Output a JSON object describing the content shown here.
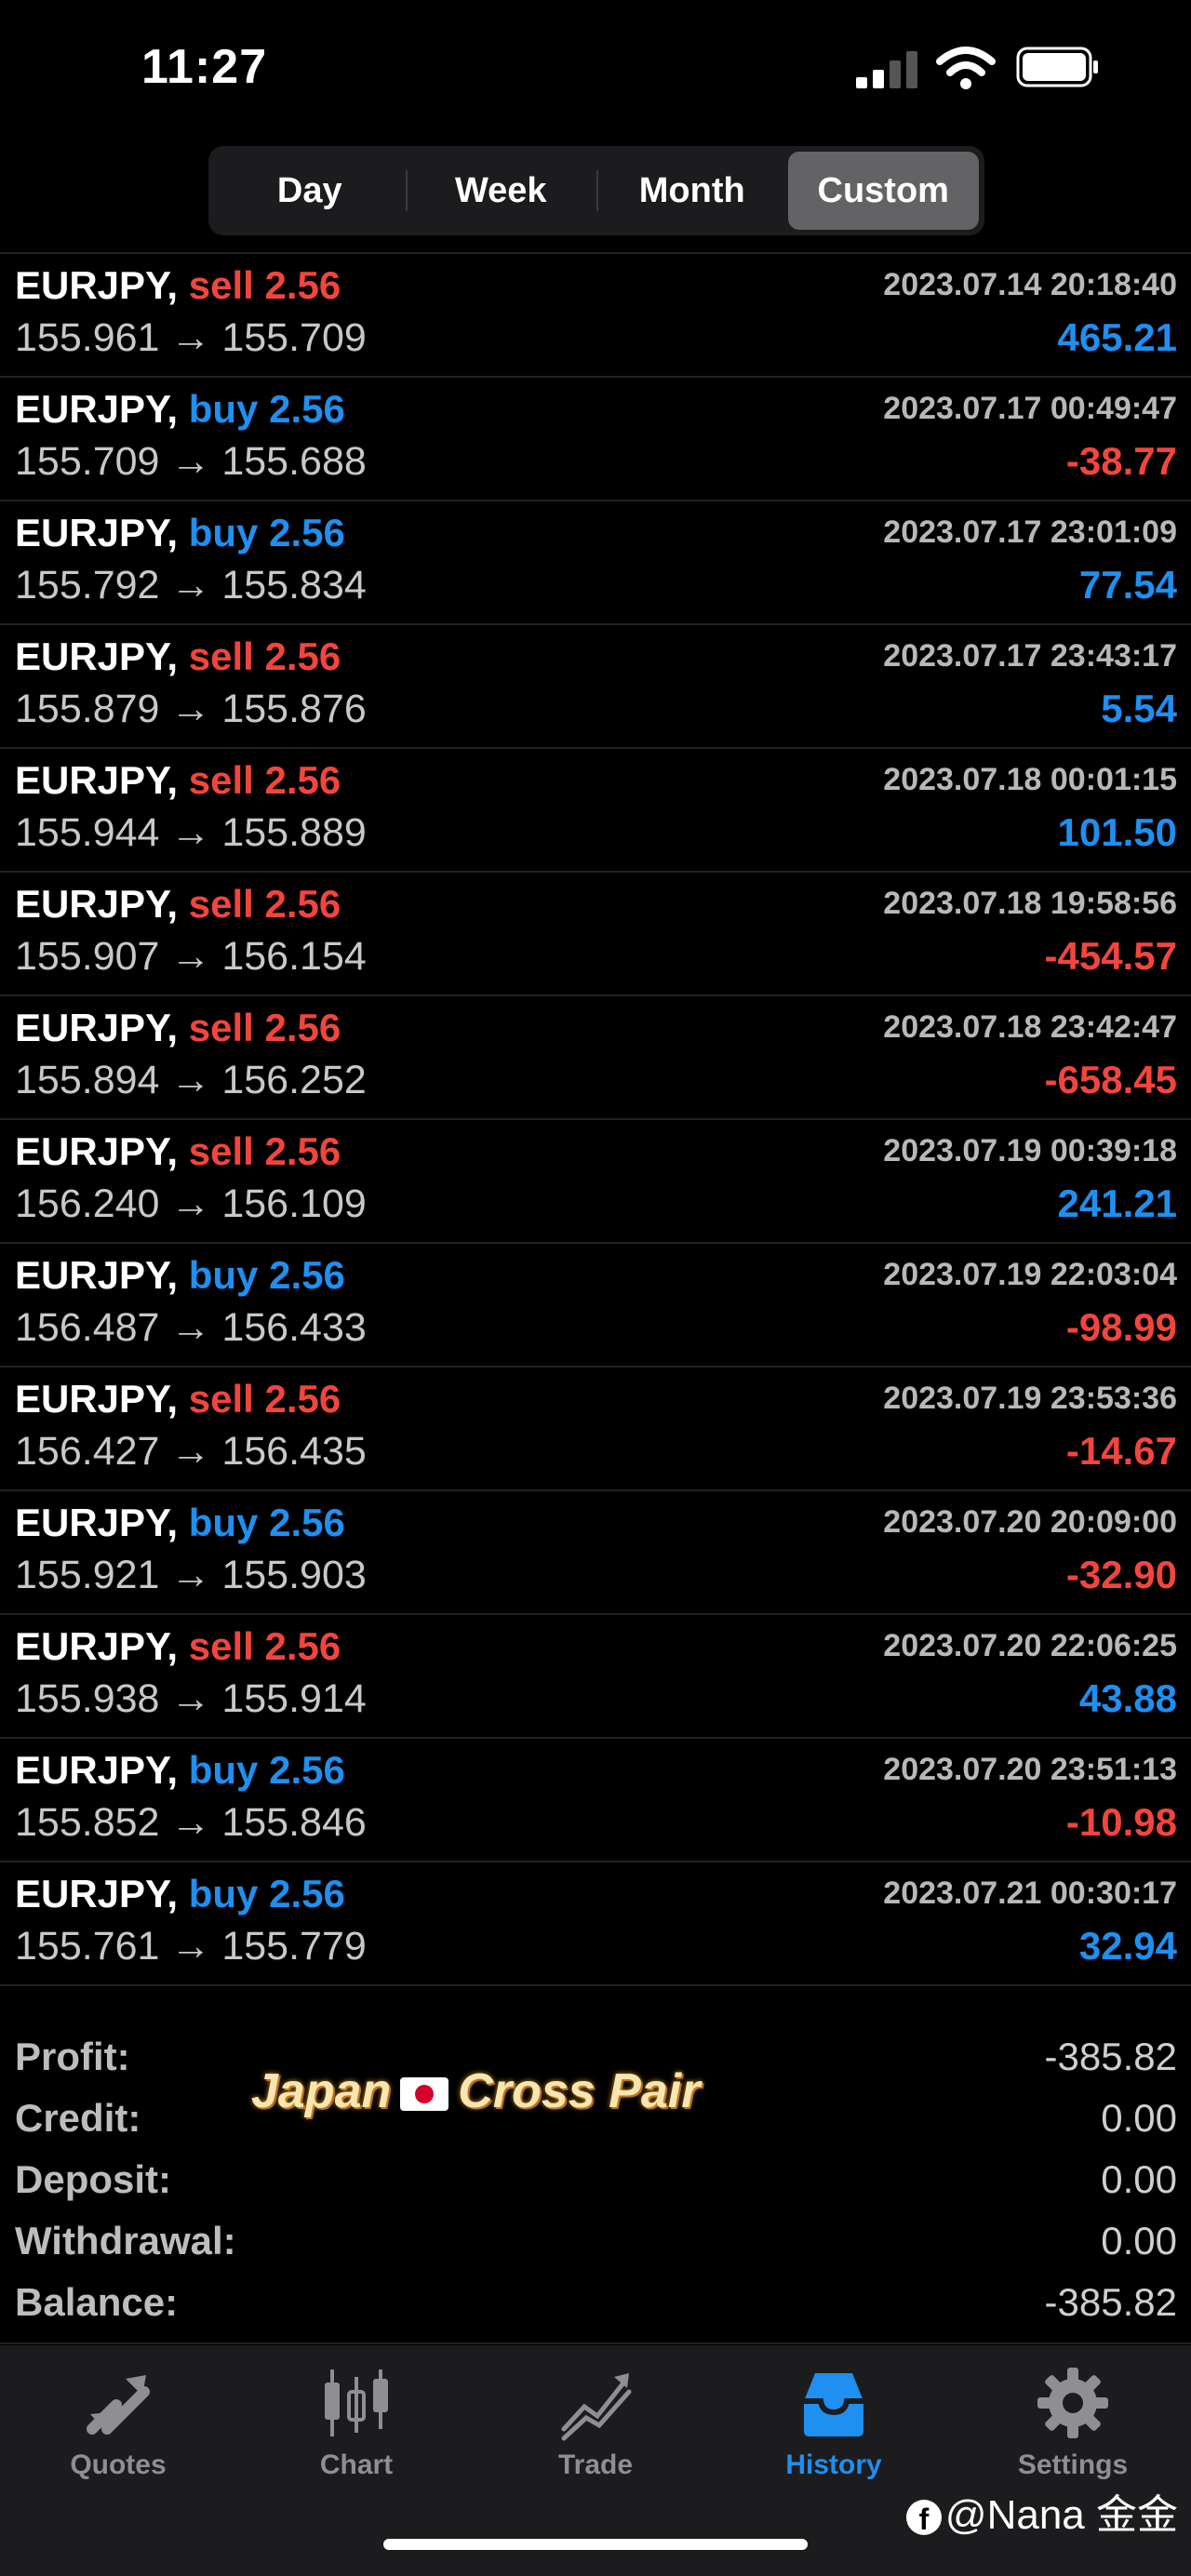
{
  "status": {
    "time": "11:27"
  },
  "segments": {
    "items": [
      "Day",
      "Week",
      "Month",
      "Custom"
    ],
    "active": "Custom"
  },
  "deals": [
    {
      "symbol": "EURJPY,",
      "side": "sell",
      "volume": "2.56",
      "open": "155.961",
      "close": "155.709",
      "time": "2023.07.14 20:18:40",
      "profit": "465.21"
    },
    {
      "symbol": "EURJPY,",
      "side": "buy",
      "volume": "2.56",
      "open": "155.709",
      "close": "155.688",
      "time": "2023.07.17 00:49:47",
      "profit": "-38.77"
    },
    {
      "symbol": "EURJPY,",
      "side": "buy",
      "volume": "2.56",
      "open": "155.792",
      "close": "155.834",
      "time": "2023.07.17 23:01:09",
      "profit": "77.54"
    },
    {
      "symbol": "EURJPY,",
      "side": "sell",
      "volume": "2.56",
      "open": "155.879",
      "close": "155.876",
      "time": "2023.07.17 23:43:17",
      "profit": "5.54"
    },
    {
      "symbol": "EURJPY,",
      "side": "sell",
      "volume": "2.56",
      "open": "155.944",
      "close": "155.889",
      "time": "2023.07.18 00:01:15",
      "profit": "101.50"
    },
    {
      "symbol": "EURJPY,",
      "side": "sell",
      "volume": "2.56",
      "open": "155.907",
      "close": "156.154",
      "time": "2023.07.18 19:58:56",
      "profit": "-454.57"
    },
    {
      "symbol": "EURJPY,",
      "side": "sell",
      "volume": "2.56",
      "open": "155.894",
      "close": "156.252",
      "time": "2023.07.18 23:42:47",
      "profit": "-658.45"
    },
    {
      "symbol": "EURJPY,",
      "side": "sell",
      "volume": "2.56",
      "open": "156.240",
      "close": "156.109",
      "time": "2023.07.19 00:39:18",
      "profit": "241.21"
    },
    {
      "symbol": "EURJPY,",
      "side": "buy",
      "volume": "2.56",
      "open": "156.487",
      "close": "156.433",
      "time": "2023.07.19 22:03:04",
      "profit": "-98.99"
    },
    {
      "symbol": "EURJPY,",
      "side": "sell",
      "volume": "2.56",
      "open": "156.427",
      "close": "156.435",
      "time": "2023.07.19 23:53:36",
      "profit": "-14.67"
    },
    {
      "symbol": "EURJPY,",
      "side": "buy",
      "volume": "2.56",
      "open": "155.921",
      "close": "155.903",
      "time": "2023.07.20 20:09:00",
      "profit": "-32.90"
    },
    {
      "symbol": "EURJPY,",
      "side": "sell",
      "volume": "2.56",
      "open": "155.938",
      "close": "155.914",
      "time": "2023.07.20 22:06:25",
      "profit": "43.88"
    },
    {
      "symbol": "EURJPY,",
      "side": "buy",
      "volume": "2.56",
      "open": "155.852",
      "close": "155.846",
      "time": "2023.07.20 23:51:13",
      "profit": "-10.98"
    },
    {
      "symbol": "EURJPY,",
      "side": "buy",
      "volume": "2.56",
      "open": "155.761",
      "close": "155.779",
      "time": "2023.07.21 00:30:17",
      "profit": "32.94"
    }
  ],
  "summary": [
    {
      "label": "Profit:",
      "value": "-385.82"
    },
    {
      "label": "Credit:",
      "value": "0.00"
    },
    {
      "label": "Deposit:",
      "value": "0.00"
    },
    {
      "label": "Withdrawal:",
      "value": "0.00"
    },
    {
      "label": "Balance:",
      "value": "-385.82"
    }
  ],
  "overlay": {
    "left": "Japan",
    "right": "Cross Pair"
  },
  "tabs": [
    {
      "label": "Quotes",
      "icon": "quotes-icon"
    },
    {
      "label": "Chart",
      "icon": "chart-icon"
    },
    {
      "label": "Trade",
      "icon": "trade-icon"
    },
    {
      "label": "History",
      "icon": "history-icon",
      "active": true
    },
    {
      "label": "Settings",
      "icon": "settings-icon"
    }
  ],
  "watermark": "@Nana 金金",
  "colors": {
    "sell": "#f2453d",
    "buy": "#1f8ff0",
    "profit": "#1f8ff0",
    "loss": "#f2453d",
    "active_tab": "#1f8ff0"
  }
}
